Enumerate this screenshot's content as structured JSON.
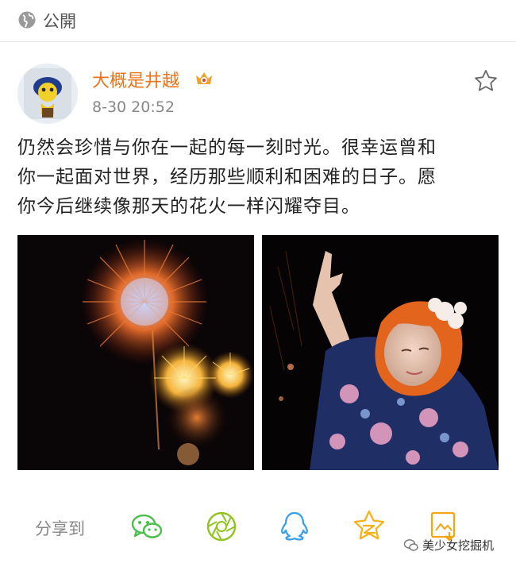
{
  "visibility": {
    "label": "公開",
    "icon": "globe-icon"
  },
  "author": {
    "name": "大概是井越",
    "timestamp": "8-30 20:52",
    "badge_icon": "vip-crown-icon"
  },
  "post": {
    "text": "仍然会珍惜与你在一起的每一刻时光。很幸运曾和\n你一起面对世界，经历那些顺利和困难的日子。愿\n你今后继续像那天的花火一样闪耀夺目。"
  },
  "share": {
    "label": "分享到",
    "targets": [
      "wechat-icon",
      "moments-icon",
      "qq-icon",
      "qzone-icon",
      "save-image-icon"
    ]
  },
  "watermark": {
    "text": "美少女挖掘机"
  },
  "colors": {
    "accent_orange": "#e8741d",
    "wechat_green": "#4cbf4b",
    "moments_green": "#8fc31f",
    "qq_blue": "#3aa0e8",
    "qzone_yellow": "#f5b21b",
    "save_orange": "#f2a516"
  }
}
